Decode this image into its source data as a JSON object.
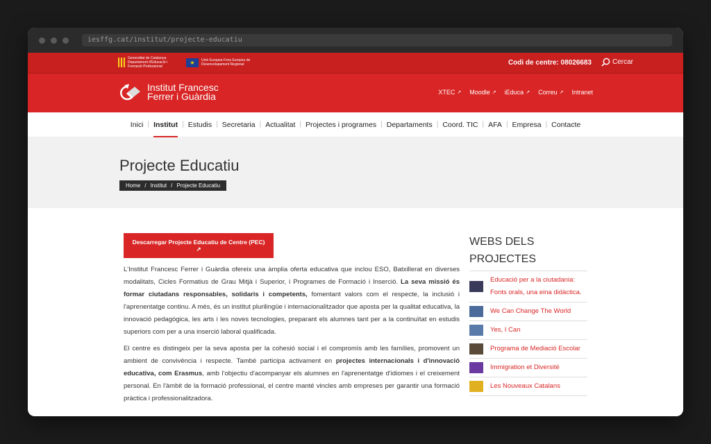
{
  "browser": {
    "url": "iesffg.cat/institut/projecte-educatiu"
  },
  "topbar": {
    "gencat_text": "Generalitat de Catalunya Departament d'Educació i Formació Professional",
    "eu_text": "Unió Europea Fons Europeu de Desenvolupament Regional",
    "codi": "Codi de centre: 08026683",
    "search_label": "Cercar"
  },
  "header": {
    "brand_line1": "Institut Francesc",
    "brand_line2": "Ferrer i Guàrdia",
    "links": [
      "XTEC",
      "Moodle",
      "iEduca",
      "Correu",
      "Intranet"
    ]
  },
  "nav": {
    "items": [
      "Inici",
      "Institut",
      "Estudis",
      "Secretaria",
      "Actualitat",
      "Projectes i programes",
      "Departaments",
      "Coord. TIC",
      "AFA",
      "Empresa",
      "Contacte"
    ],
    "active": "Institut"
  },
  "hero": {
    "title": "Projecte Educatiu",
    "breadcrumb": [
      "Home",
      "Institut",
      "Projecte Educatiu"
    ]
  },
  "main": {
    "download_label": "Descarregar Projecte Educatiu de Centre (PEC)",
    "p1_a": "L'Institut Francesc Ferrer i Guàrdia ofereix una àmplia oferta educativa que inclou ESO, Batxillerat en diverses modalitats, Cicles Formatius de Grau Mitjà i Superior, i Programes de Formació i Inserció. ",
    "p1_b": "La seva missió és formar ciutadans responsables, solidaris i competents,",
    "p1_c": " fomentant valors com el respecte, la inclusió i l'aprenentatge continu. A més, és un institut plurilingüe i internacionalitzador que aposta per la qualitat educativa, la innovació pedagògica, les arts i les noves tecnologies, preparant els alumnes tant per a la continuïtat en estudis superiors com per a una inserció laboral qualificada.",
    "p2_a": "El centre es distingeix per la seva aposta per la cohesió social i el compromís amb les famílies, promovent un ambient de convivència i respecte. També participa activament en ",
    "p2_b": "projectes internacionals i d'innovació educativa, com Erasmus",
    "p2_c": ", amb l'objectiu d'acompanyar els alumnes en l'aprenentatge d'idiomes i el creixement personal. En l'àmbit de la formació professional, el centre manté vincles amb empreses per garantir una formació pràctica i professionalitzadora."
  },
  "side": {
    "title": "WEBS DELS PROJECTES",
    "items": [
      {
        "label": "Educació per a la ciutadania: Fonts orals, una eina didàctica.",
        "color": "#3a3a5a"
      },
      {
        "label": "We Can Change The World",
        "color": "#4a6a9a"
      },
      {
        "label": "Yes, I Can",
        "color": "#5a7aaa"
      },
      {
        "label": "Programa de Mediació Escolar",
        "color": "#5a4a3a"
      },
      {
        "label": "Immigration et Diversité",
        "color": "#6a3aa0"
      },
      {
        "label": "Les Nouveaux Catalans",
        "color": "#e0b020"
      }
    ]
  }
}
